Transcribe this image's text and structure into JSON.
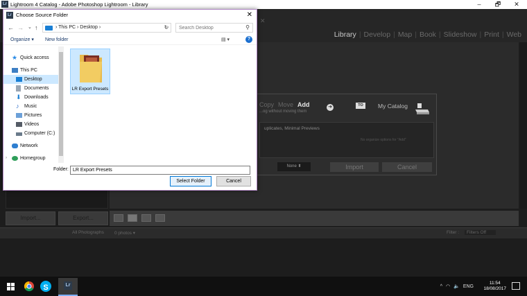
{
  "lightroom": {
    "window_title": "Lightroom 4 Catalog - Adobe Photoshop Lightroom - Library",
    "app_icon": "Lr",
    "controls": {
      "minimize": "–",
      "maximize": "🗗",
      "close": "✕"
    },
    "menu_glyph": "✕",
    "modules": [
      "Library",
      "Develop",
      "Map",
      "Book",
      "Slideshow",
      "Print",
      "Web"
    ],
    "active_module": "Library",
    "bottom_buttons": [
      "Import...",
      "Export..."
    ],
    "filmstrip": {
      "source": "All Photographs",
      "count": "0 photos ▾",
      "filter_label": "Filter :",
      "filter_value": "Filters Off"
    }
  },
  "import_panel": {
    "modes": [
      "Copy",
      "Move",
      "Add"
    ],
    "active_mode": "Add",
    "mode_description": "...og without moving them",
    "to_badge": "TO",
    "destination": "My Catalog",
    "previews_text": "uplicates, Minimal Previews",
    "hint_text": "No organize options for \"Add\"",
    "preset": "None ⬍",
    "import_label": "Import",
    "cancel_label": "Cancel"
  },
  "dialog": {
    "icon": "Lr",
    "title": "Choose Source Folder",
    "close": "✕",
    "nav": {
      "back": "←",
      "forward": "→",
      "recent": "⌄",
      "up": "↑"
    },
    "address_path": "›  This PC  ›  Desktop  ›",
    "address_dropdown": "⌄",
    "refresh": "↻",
    "search_placeholder": "Search Desktop",
    "search_icon": "⚲",
    "organize_label": "Organize ▾",
    "new_folder_label": "New folder",
    "view_label": "▤ ▾",
    "help_label": "?",
    "nav_items": [
      {
        "label": "Quick access",
        "color": "#2a8be6"
      },
      {
        "label": "This PC",
        "color": "#3d7fc4"
      },
      {
        "label": "Desktop",
        "color": "#1a7fd4"
      },
      {
        "label": "Documents",
        "color": "#9aa6b3"
      },
      {
        "label": "Downloads",
        "color": "#1a7fd4"
      },
      {
        "label": "Music",
        "color": "#2a6cc8"
      },
      {
        "label": "Pictures",
        "color": "#6ca0d8"
      },
      {
        "label": "Videos",
        "color": "#555c66"
      },
      {
        "label": "Computer (C:)",
        "color": "#6a7a8a"
      },
      {
        "label": "Network",
        "color": "#2f7fd0"
      },
      {
        "label": "Homegroup",
        "color": "#2f9e5a"
      }
    ],
    "folder_item": "LR Export Presets",
    "folder_field_label": "Folder:",
    "folder_field_value": "LR Export Presets",
    "select_button": "Select Folder",
    "cancel_button": "Cancel"
  },
  "taskbar": {
    "tray_chevron": "^",
    "language": "ENG",
    "time": "11:54",
    "date": "18/08/2017",
    "lr_label": "Lr",
    "skype_label": "S"
  }
}
